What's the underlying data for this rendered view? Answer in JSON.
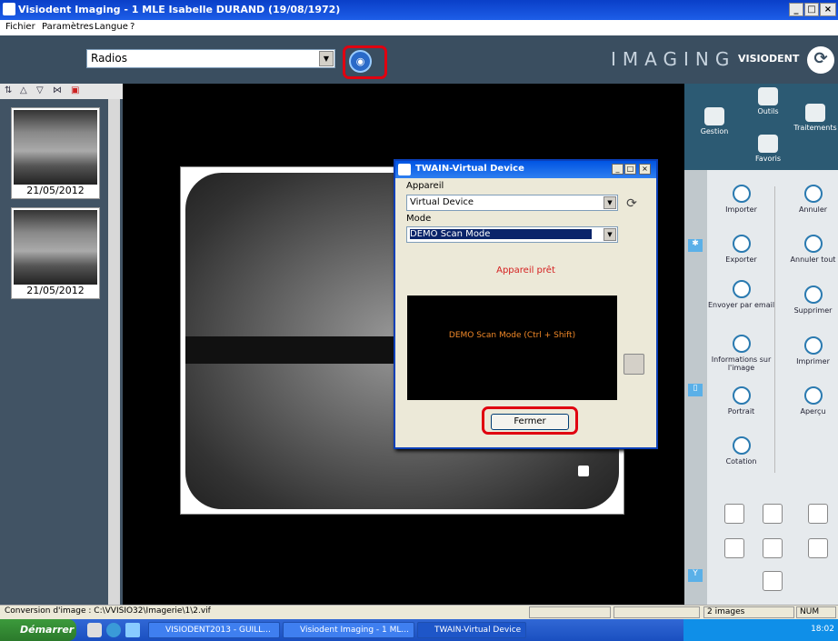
{
  "window": {
    "title": "Visiodent Imaging - 1 MLE Isabelle DURAND (19/08/1972)",
    "btn_min": "_",
    "btn_max": "□",
    "btn_close": "×"
  },
  "menu": {
    "items": [
      "Fichier",
      "Paramètres",
      "Langue",
      "?"
    ]
  },
  "toolbar": {
    "selector_value": "Radios",
    "imaging_label": "IMAGING",
    "brand": "VISIODENT"
  },
  "thumbnails": [
    {
      "date": "21/05/2012"
    },
    {
      "date": "21/05/2012"
    }
  ],
  "right_top": {
    "gestion": "Gestion",
    "outils": "Outils",
    "traitements": "Traitements",
    "favoris": "Favoris"
  },
  "actions": [
    {
      "label": "Importer",
      "icon": "import-icon"
    },
    {
      "label": "Annuler",
      "icon": "undo-icon"
    },
    {
      "label": "Exporter",
      "icon": "export-icon"
    },
    {
      "label": "Annuler tout",
      "icon": "undo-all-icon"
    },
    {
      "label": "Envoyer par email",
      "icon": "email-icon"
    },
    {
      "label": "Supprimer",
      "icon": "trash-icon"
    },
    {
      "label": "Informations sur l'image",
      "icon": "info-icon"
    },
    {
      "label": "Imprimer",
      "icon": "print-icon"
    },
    {
      "label": "Portrait",
      "icon": "portrait-icon"
    },
    {
      "label": "Aperçu",
      "icon": "preview-icon"
    },
    {
      "label": "Cotation",
      "icon": "cotation-icon"
    }
  ],
  "dialog": {
    "title": "TWAIN-Virtual Device",
    "device_label": "Appareil",
    "device_value": "Virtual Device",
    "mode_label": "Mode",
    "mode_value": "DEMO Scan Mode",
    "status": "Appareil prêt",
    "preview_text": "DEMO Scan Mode (Ctrl + Shift)",
    "close_button": "Fermer"
  },
  "statusbar": {
    "path": "Conversion d'image : C:\\VVISIO32\\Imagerie\\1\\2.vif",
    "count": "2 images",
    "num": "NUM"
  },
  "taskbar": {
    "start": "Démarrer",
    "tasks": [
      "VISIODENT2013 - GUILL...",
      "Visiodent Imaging - 1 ML...",
      "TWAIN-Virtual Device"
    ],
    "clock": "18:02"
  },
  "colors": {
    "highlight": "#e00010",
    "status_text": "#d42020",
    "preview_text": "#f08828"
  }
}
